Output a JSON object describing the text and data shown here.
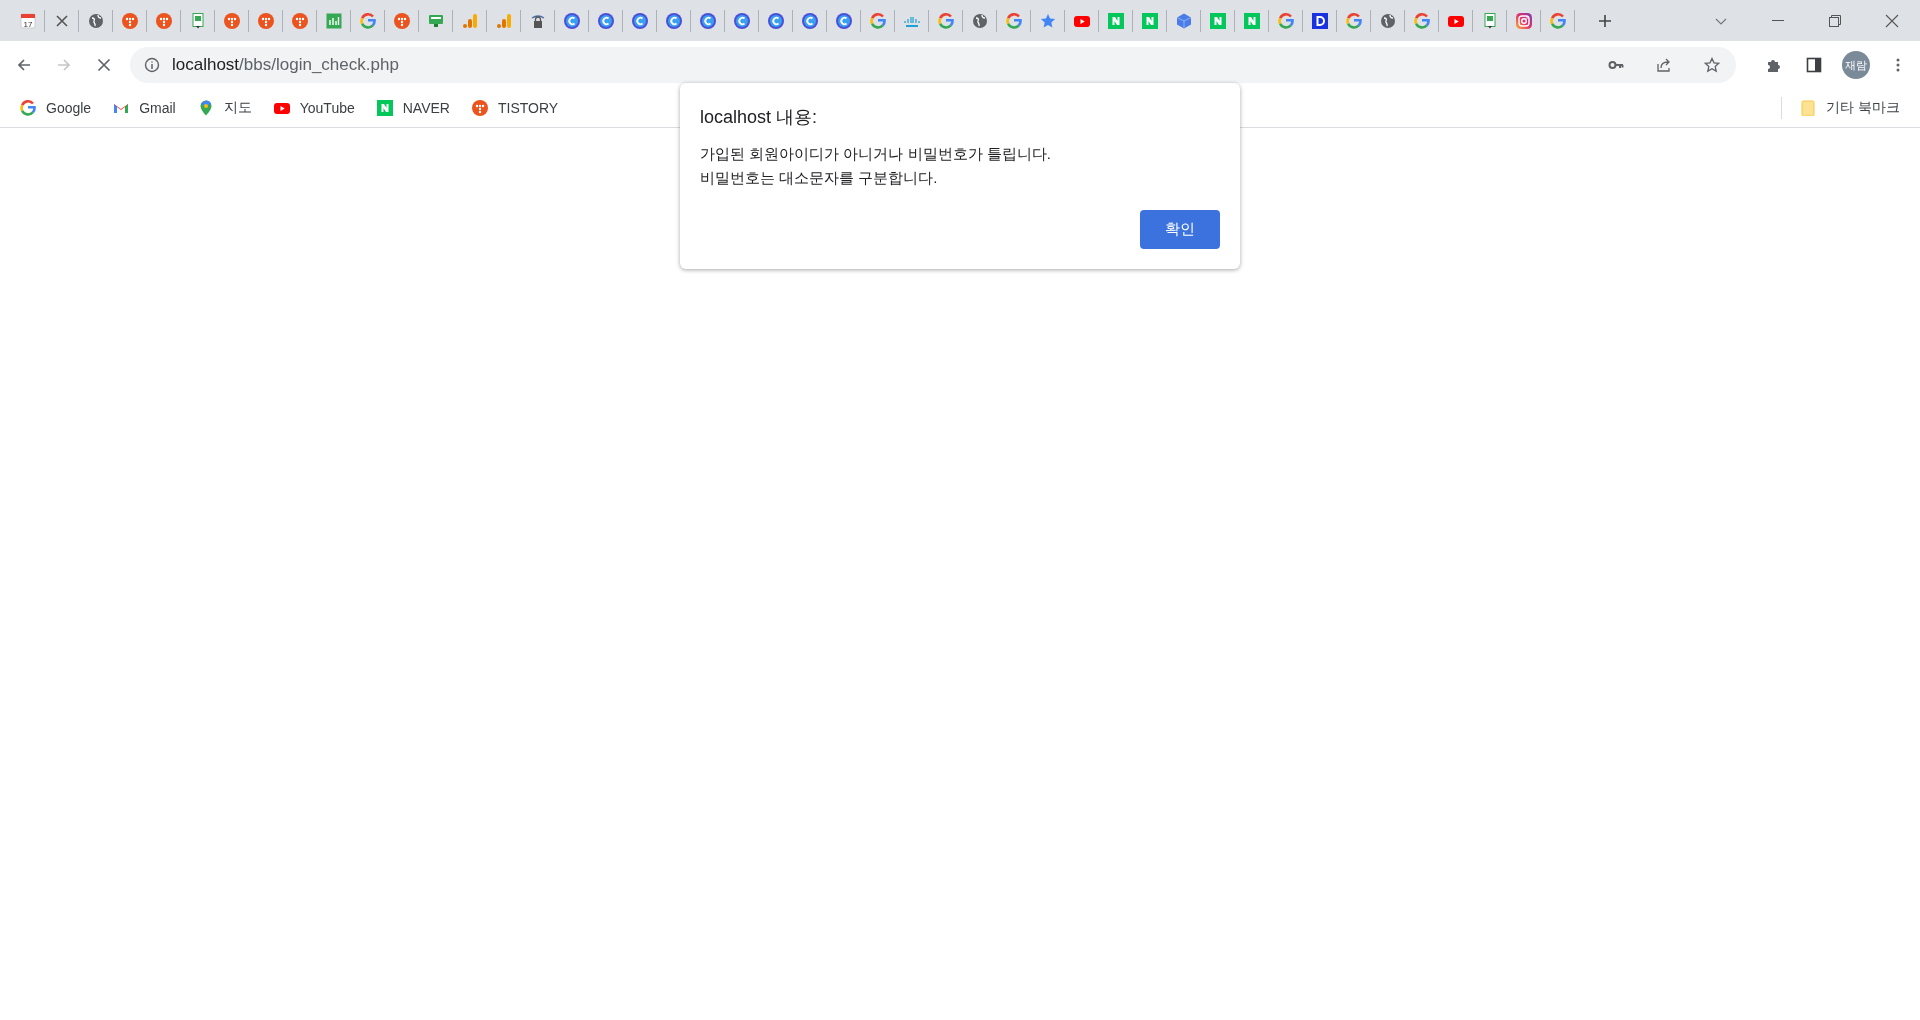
{
  "tabs": [
    {
      "kind": "calendar",
      "label": "17"
    },
    {
      "kind": "close"
    },
    {
      "kind": "globe"
    },
    {
      "kind": "tistory"
    },
    {
      "kind": "tistory"
    },
    {
      "kind": "sheet"
    },
    {
      "kind": "tistory"
    },
    {
      "kind": "tistory"
    },
    {
      "kind": "tistory"
    },
    {
      "kind": "chart"
    },
    {
      "kind": "google"
    },
    {
      "kind": "tistory"
    },
    {
      "kind": "monitor"
    },
    {
      "kind": "analytics"
    },
    {
      "kind": "analytics"
    },
    {
      "kind": "lock"
    },
    {
      "kind": "c-logo"
    },
    {
      "kind": "c-logo"
    },
    {
      "kind": "c-logo"
    },
    {
      "kind": "c-logo"
    },
    {
      "kind": "c-logo"
    },
    {
      "kind": "c-logo"
    },
    {
      "kind": "c-logo"
    },
    {
      "kind": "c-logo"
    },
    {
      "kind": "c-logo"
    },
    {
      "kind": "google"
    },
    {
      "kind": "cisco"
    },
    {
      "kind": "google"
    },
    {
      "kind": "globe"
    },
    {
      "kind": "google"
    },
    {
      "kind": "star"
    },
    {
      "kind": "youtube"
    },
    {
      "kind": "naver"
    },
    {
      "kind": "naver"
    },
    {
      "kind": "cube"
    },
    {
      "kind": "naver"
    },
    {
      "kind": "naver"
    },
    {
      "kind": "google"
    },
    {
      "kind": "d-logo"
    },
    {
      "kind": "google"
    },
    {
      "kind": "globe"
    },
    {
      "kind": "google"
    },
    {
      "kind": "youtube"
    },
    {
      "kind": "sheet"
    },
    {
      "kind": "instagram"
    },
    {
      "kind": "google"
    }
  ],
  "address_bar": {
    "host": "localhost",
    "path": "/bbs/login_check.php"
  },
  "profile": {
    "initials": "재람"
  },
  "bookmarks": [
    {
      "kind": "google",
      "label": "Google"
    },
    {
      "kind": "gmail",
      "label": "Gmail"
    },
    {
      "kind": "maps",
      "label": "지도"
    },
    {
      "kind": "youtube",
      "label": "YouTube"
    },
    {
      "kind": "naver",
      "label": "NAVER"
    },
    {
      "kind": "tistory",
      "label": "TISTORY"
    }
  ],
  "other_bookmarks": {
    "label": "기타 북마크"
  },
  "dialog": {
    "title": "localhost 내용:",
    "lines": [
      "가입된 회원아이디가 아니거나 비밀번호가 틀립니다.",
      "비밀번호는 대소문자를 구분합니다."
    ],
    "button": "확인"
  }
}
